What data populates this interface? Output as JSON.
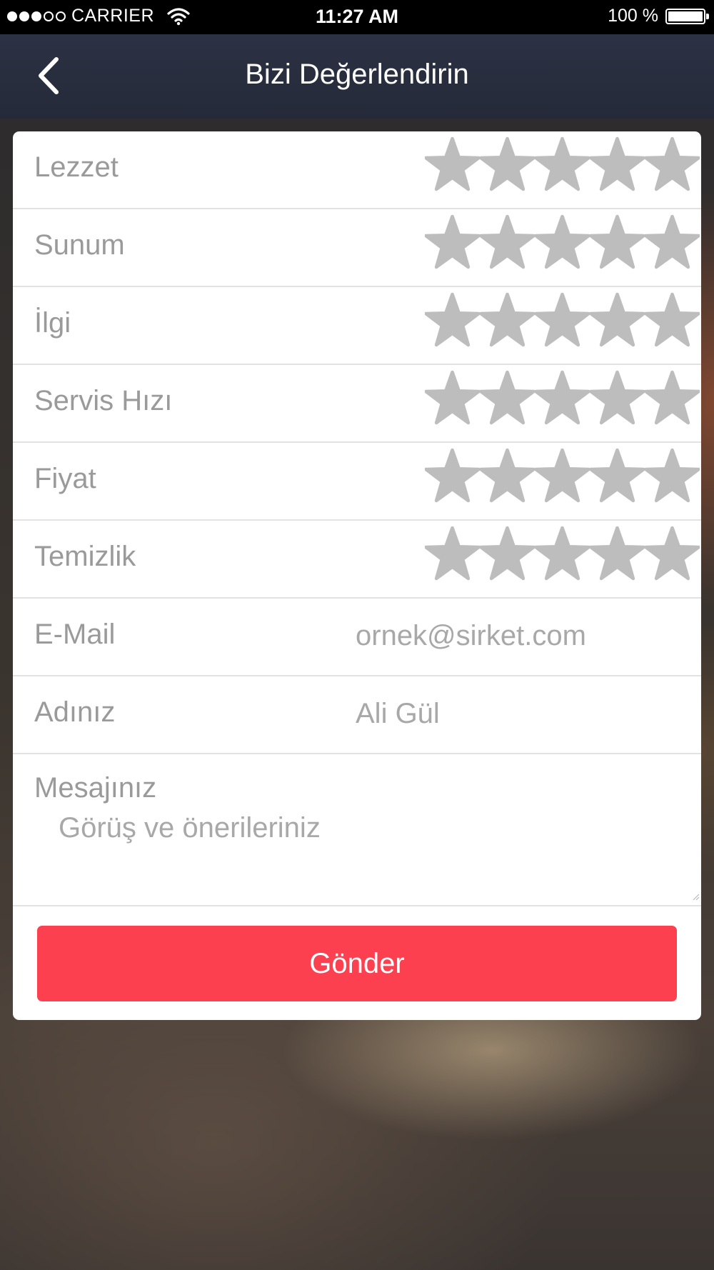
{
  "status_bar": {
    "carrier": "CARRIER",
    "time": "11:27 AM",
    "battery_text": "100 %",
    "signal_bars_filled": 3,
    "signal_bars_total": 5
  },
  "header": {
    "title": "Bizi Değerlendirin",
    "back_icon": "chevron-left-icon"
  },
  "ratings": [
    {
      "label": "Lezzet",
      "value": 0,
      "max": 5
    },
    {
      "label": "Sunum",
      "value": 0,
      "max": 5
    },
    {
      "label": "İlgi",
      "value": 0,
      "max": 5
    },
    {
      "label": "Servis Hızı",
      "value": 0,
      "max": 5
    },
    {
      "label": "Fiyat",
      "value": 0,
      "max": 5
    },
    {
      "label": "Temizlik",
      "value": 0,
      "max": 5
    }
  ],
  "star_icon": "star-icon",
  "star_color": "#bdbdbd",
  "form": {
    "email": {
      "label": "E-Mail",
      "value": "",
      "placeholder": "ornek@sirket.com"
    },
    "name": {
      "label": "Adınız",
      "value": "",
      "placeholder": "Ali Gül"
    },
    "message": {
      "label": "Mesajınız",
      "value": "",
      "placeholder": "Görüş ve önerileriniz"
    }
  },
  "submit_label": "Gönder",
  "colors": {
    "nav_bar": "#2a2f40",
    "accent": "#fc4050",
    "label_text": "#9a9a9a"
  }
}
